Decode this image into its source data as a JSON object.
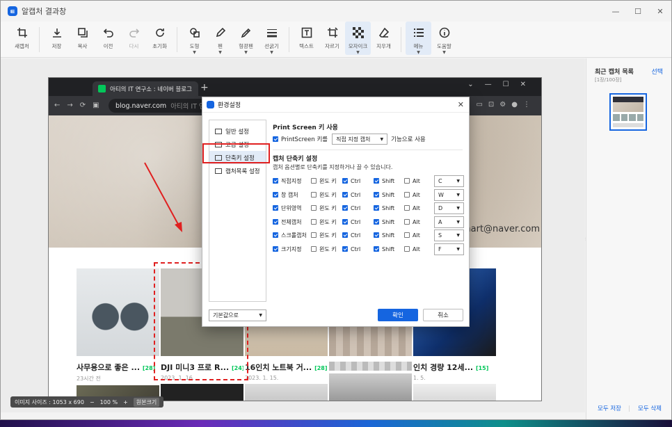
{
  "app": {
    "title": "알캡처 결과창"
  },
  "window_controls": {
    "minimize": "—",
    "maximize": "☐",
    "close": "✕"
  },
  "toolbar": {
    "new_capture": "새캡처",
    "save": "저장",
    "copy": "복사",
    "undo": "이전",
    "redo": "다시",
    "reset": "초기화",
    "shape": "도형",
    "pen": "펜",
    "highlighter": "형광펜",
    "line_width": "선굵기",
    "text": "텍스트",
    "crop": "자르기",
    "mosaic": "모자이크",
    "eraser": "지우개",
    "menu": "메뉴",
    "help": "도움말"
  },
  "browser": {
    "tab_title": "아티의 IT 연구소 : 네이버 블로그",
    "url": "blog.naver.com",
    "url_suffix": "아티의 IT 연구소 : 네이버 블로그",
    "new_tab": "+"
  },
  "page": {
    "email": "smart@naver.com",
    "cards": [
      {
        "title": "사무용으로 좋은 ...",
        "count": "[28]",
        "date": "23시간 전"
      },
      {
        "title": "DJI 미니3 프로 R...",
        "count": "[24]",
        "date": "2023. 1. 16."
      },
      {
        "title": "16인치 노트북 거...",
        "count": "[28]",
        "date": "2023. 1. 15."
      },
      {
        "title": "",
        "count": "",
        "date": ""
      },
      {
        "title": "인치 경량 12세...",
        "count": "[15]",
        "date": "1. 5."
      }
    ]
  },
  "status": {
    "image_size": "이미지 사이즈 : 1053 x 690",
    "zoom": "100 %",
    "zoom_minus": "−",
    "zoom_plus": "+",
    "original_size": "원본크기"
  },
  "right_panel": {
    "title": "최근 캡처 목록",
    "select": "선택",
    "count": "[1장/100장]",
    "save_all": "모두 저장",
    "delete_all": "모두 삭제",
    "separator": "|"
  },
  "dialog": {
    "title": "환경설정",
    "close": "✕",
    "nav": [
      "일반 설정",
      "고급 설정",
      "단축키 설정",
      "캡처목록 설정"
    ],
    "print_screen": {
      "heading": "Print Screen 키 사용",
      "checkbox_label": "PrintScreen 키를",
      "mode": "직접 지정 캡처",
      "suffix": "기능으로 사용"
    },
    "shortcut": {
      "heading": "캡처 단축키 설정",
      "desc": "캡처 옵션별로 단축키를 지정하거나 끌 수 있습니다.",
      "win_label": "윈도 키",
      "ctrl_label": "Ctrl",
      "shift_label": "Shift",
      "alt_label": "Alt",
      "rows": [
        {
          "name": "직접지정",
          "key": "C"
        },
        {
          "name": "창 캡처",
          "key": "W"
        },
        {
          "name": "단위영역",
          "key": "D"
        },
        {
          "name": "전체캡처",
          "key": "A"
        },
        {
          "name": "스크롤캡처",
          "key": "S"
        },
        {
          "name": "크기지정",
          "key": "F"
        }
      ]
    },
    "default_btn": "기본값으로",
    "ok": "확인",
    "cancel": "취소"
  },
  "colors": {
    "accent": "#1565e0",
    "highlight_red": "#e02020",
    "naver_green": "#03c75a"
  }
}
